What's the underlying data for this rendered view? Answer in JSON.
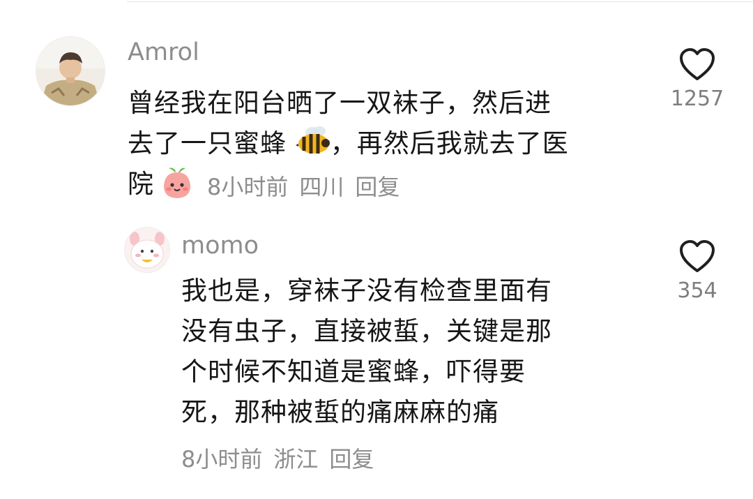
{
  "comments": [
    {
      "username": "Amrol",
      "lines": [
        "曾经我在阳台晒了一双袜子，然后进",
        "去了一只蜜蜂",
        "，再然后我就去了医",
        "院"
      ],
      "emoji_names": [
        "bee-emoji",
        "peach-face-emoji"
      ],
      "time": "8小时前",
      "location": "四川",
      "reply_label": "回复",
      "likes": "1257",
      "icon": "heart-outline-icon"
    },
    {
      "username": "momo",
      "lines": [
        "我也是，穿袜子没有检查里面有",
        "没有虫子，直接被蜇，关键是那",
        "个时候不知道是蜜蜂，吓得要",
        "死，那种被蜇的痛麻麻的痛"
      ],
      "time": "8小时前",
      "location": "浙江",
      "reply_label": "回复",
      "likes": "354",
      "icon": "heart-outline-icon"
    }
  ],
  "colors": {
    "text": "#161616",
    "meta": "#8d8d8d",
    "background": "#ffffff"
  }
}
